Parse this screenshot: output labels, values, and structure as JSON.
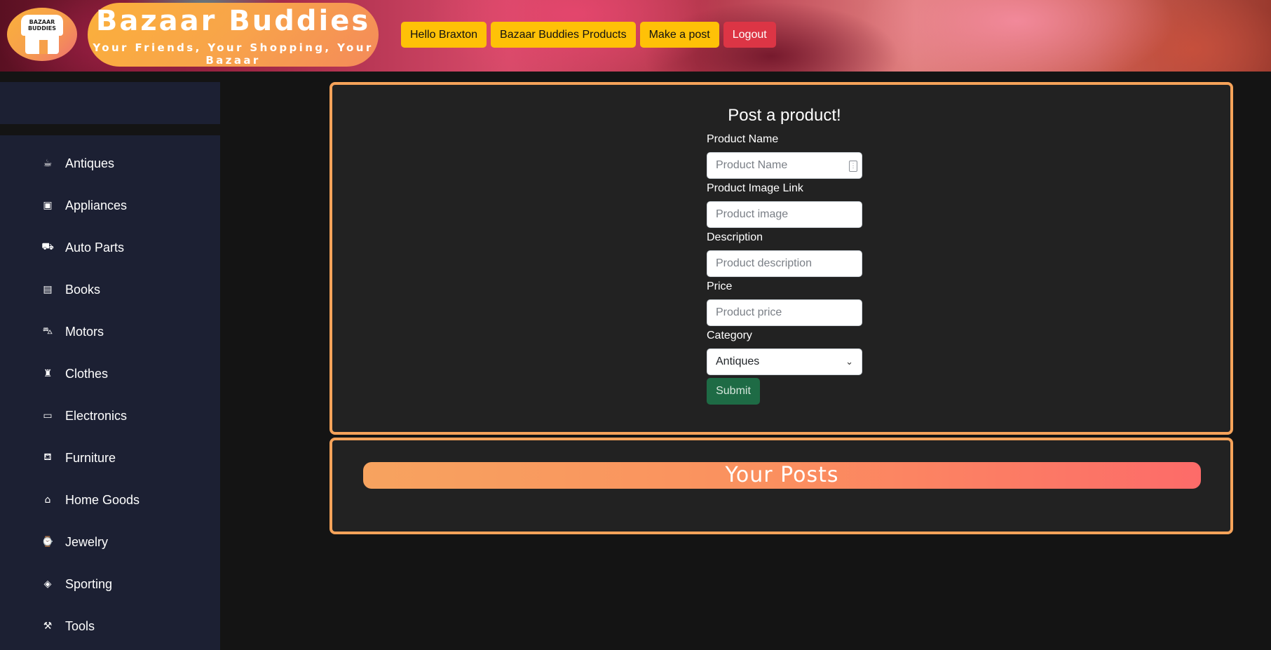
{
  "header": {
    "logo_text_line1": "BAZAAR",
    "logo_text_line2": "BUDDIES",
    "brand_title": "Bazaar Buddies",
    "brand_subtitle": "Your Friends, Your Shopping, Your Bazaar",
    "nav": {
      "greeting": "Hello Braxton",
      "products": "Bazaar Buddies Products",
      "make_post": "Make a post",
      "logout": "Logout"
    },
    "colors": {
      "nav_button": "#ffc107",
      "logout_button": "#dc3545",
      "accent": "#f6a35a"
    }
  },
  "sidebar": {
    "items": [
      {
        "label": "Antiques",
        "icon": "teacup-icon",
        "glyph": "☕"
      },
      {
        "label": "Appliances",
        "icon": "blender-icon",
        "glyph": "▣"
      },
      {
        "label": "Auto Parts",
        "icon": "car-seat-icon",
        "glyph": "⛟"
      },
      {
        "label": "Books",
        "icon": "book-icon",
        "glyph": "▤"
      },
      {
        "label": "Motors",
        "icon": "car-icon",
        "glyph": "⛍"
      },
      {
        "label": "Clothes",
        "icon": "shirt-icon",
        "glyph": "♜"
      },
      {
        "label": "Electronics",
        "icon": "monitor-icon",
        "glyph": "▭"
      },
      {
        "label": "Furniture",
        "icon": "couch-icon",
        "glyph": "⛾"
      },
      {
        "label": "Home Goods",
        "icon": "bed-icon",
        "glyph": "⌂"
      },
      {
        "label": "Jewelry",
        "icon": "watch-icon",
        "glyph": "⌚"
      },
      {
        "label": "Sporting",
        "icon": "football-icon",
        "glyph": "◈"
      },
      {
        "label": "Tools",
        "icon": "hammer-icon",
        "glyph": "⚒"
      }
    ]
  },
  "post_form": {
    "title": "Post a product!",
    "fields": [
      {
        "label": "Product Name",
        "placeholder": "Product Name"
      },
      {
        "label": "Product Image Link",
        "placeholder": "Product image"
      },
      {
        "label": "Description",
        "placeholder": "Product description"
      },
      {
        "label": "Price",
        "placeholder": "Product price"
      }
    ],
    "category": {
      "label": "Category",
      "selected": "Antiques"
    },
    "submit_label": "Submit"
  },
  "your_posts": {
    "title": "Your Posts"
  }
}
